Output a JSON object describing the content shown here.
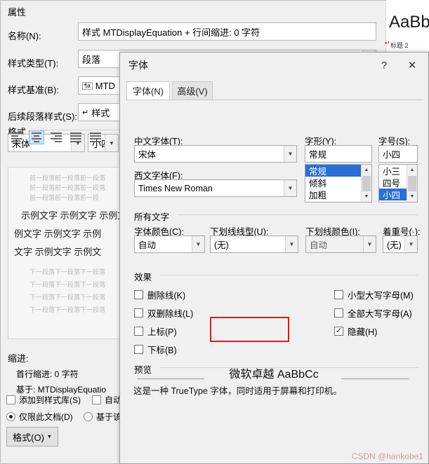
{
  "style_dialog": {
    "title": "属性",
    "labels": {
      "name": "名称(N):",
      "style_type": "样式类型(T):",
      "style_based_on": "样式基准(B):",
      "next_style": "后续段落样式(S):",
      "format_section": "格式",
      "indent_section": "缩进:",
      "indent_line1": "首行缩进:  0 字符",
      "indent_line2": "基于: MTDisplayEquatio"
    },
    "values": {
      "name": "样式 MTDisplayEquation + 行间缩进:  0 字符",
      "style_type": "段落",
      "style_based_on": "MTD",
      "next_style": "样式",
      "font": "宋体",
      "size": "小四"
    },
    "checkboxes": [
      {
        "label": "添加到样式库(S)",
        "checked": false
      },
      {
        "label": "自动更",
        "checked": false
      }
    ],
    "radios": [
      {
        "label": "仅限此文档(D)",
        "selected": true
      },
      {
        "label": "基于该",
        "selected": false
      }
    ],
    "format_button": "格式(O)",
    "preview_main_lines": [
      "示例文字 示例文字 示例文字",
      "例文字 示例文字 示例",
      "文字 示例文字 示例文"
    ],
    "preview_gray_top": [
      "前一段落前一段落前一段落",
      "前一段落前一段落前一段落",
      "前一段落前一段落前一段"
    ],
    "preview_gray_bottom": [
      "下一段落下一段落下一段落",
      "下一段落下一段落下一段落",
      "下一段落下一段落下一段落",
      "下一段落下一段落下一段落"
    ]
  },
  "gallery": {
    "sample": "AaBbC",
    "caption": "标题 2",
    "mark": "↵"
  },
  "font_dialog": {
    "title": "字体",
    "help_icon": "?",
    "close_icon": "✕",
    "tabs": [
      {
        "label": "字体(N)",
        "active": true
      },
      {
        "label": "高级(V)",
        "active": false
      }
    ],
    "fields": {
      "chinese_font_label": "中文字体(T):",
      "chinese_font_value": "宋体",
      "western_font_label": "西文字体(F):",
      "western_font_value": "Times New Roman",
      "style_label": "字形(Y):",
      "style_value": "常规",
      "style_options": [
        "常规",
        "倾斜",
        "加粗"
      ],
      "style_selected": "常规",
      "size_label": "字号(S):",
      "size_value": "小四",
      "size_options": [
        "小三",
        "四号",
        "小四"
      ],
      "size_selected": "小四"
    },
    "all_text": {
      "section": "所有文字",
      "font_color_label": "字体颜色(C):",
      "font_color_value": "自动",
      "underline_style_label": "下划线线型(U):",
      "underline_style_value": "(无)",
      "underline_color_label": "下划线颜色(I):",
      "underline_color_value": "自动",
      "emphasis_label": "着重号(·):",
      "emphasis_value": "(无)"
    },
    "effects": {
      "section": "效果",
      "left": [
        {
          "label": "删除线(K)",
          "checked": false
        },
        {
          "label": "双删除线(L)",
          "checked": false
        },
        {
          "label": "上标(P)",
          "checked": false
        },
        {
          "label": "下标(B)",
          "checked": false
        }
      ],
      "right": [
        {
          "label": "小型大写字母(M)",
          "checked": false
        },
        {
          "label": "全部大写字母(A)",
          "checked": false
        },
        {
          "label": "隐藏(H)",
          "checked": true
        }
      ]
    },
    "preview": {
      "section": "预览",
      "sample_text": "微软卓越  AaBbCc",
      "note": "这是一种 TrueType 字体，同时适用于屏幕和打印机。"
    },
    "highlight_color": "#e01b1b"
  },
  "watermark": "CSDN @hankobe1"
}
